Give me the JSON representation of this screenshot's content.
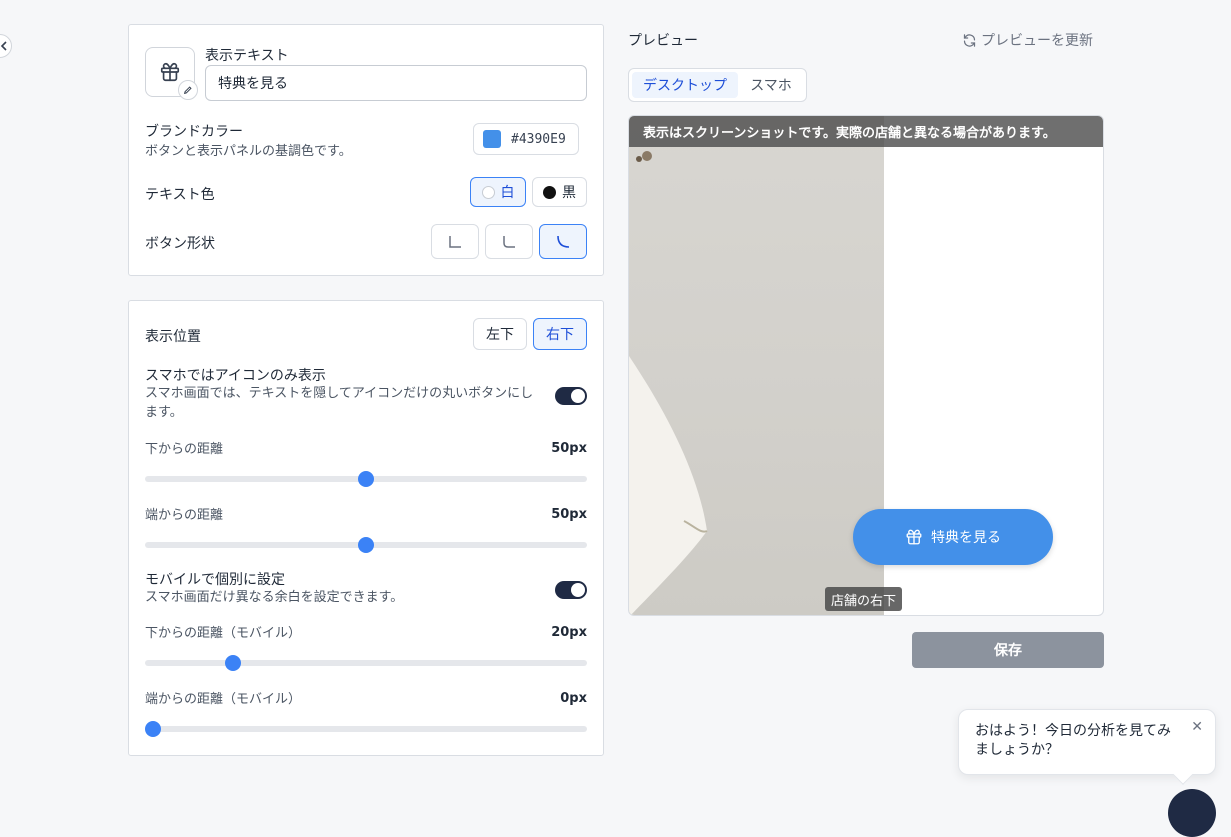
{
  "display_text": {
    "label": "表示テキスト",
    "value": "特典を見る"
  },
  "brand_color": {
    "label": "ブランドカラー",
    "description": "ボタンと表示パネルの基調色です。",
    "hex": "#4390E9"
  },
  "text_color": {
    "label": "テキスト色",
    "options": [
      "白",
      "黒"
    ],
    "selected": "白"
  },
  "button_shape": {
    "label": "ボタン形状",
    "options": [
      "square",
      "rounded",
      "pill"
    ],
    "selected": "pill"
  },
  "position": {
    "label": "表示位置",
    "options": [
      "左下",
      "右下"
    ],
    "selected": "右下"
  },
  "icon_only": {
    "label": "スマホではアイコンのみ表示",
    "description": "スマホ画面では、テキストを隠してアイコンだけの丸いボタンにします。",
    "enabled": true
  },
  "sliders": [
    {
      "label": "下からの距離",
      "value": "50px",
      "fraction": 0.5
    },
    {
      "label": "端からの距離",
      "value": "50px",
      "fraction": 0.5
    }
  ],
  "mobile": {
    "label": "モバイルで個別に設定",
    "description": "スマホ画面だけ異なる余白を設定できます。",
    "enabled": true
  },
  "mobile_sliders": [
    {
      "label": "下からの距離（モバイル）",
      "value": "20px",
      "fraction": 0.2
    },
    {
      "label": "端からの距離（モバイル）",
      "value": "0px",
      "fraction": 0.0
    }
  ],
  "preview": {
    "title": "プレビュー",
    "refresh_label": "プレビューを更新",
    "tabs": [
      "デスクトップ",
      "スマホ"
    ],
    "active_tab": "デスクトップ",
    "notice": "表示はスクリーンショットです。実際の店舗と異なる場合があります。",
    "button_label": "特典を見る",
    "position_tag": "店舗の右下"
  },
  "save_label": "保存",
  "chat": {
    "message": "おはよう！今日の分析を見てみましょうか？"
  }
}
